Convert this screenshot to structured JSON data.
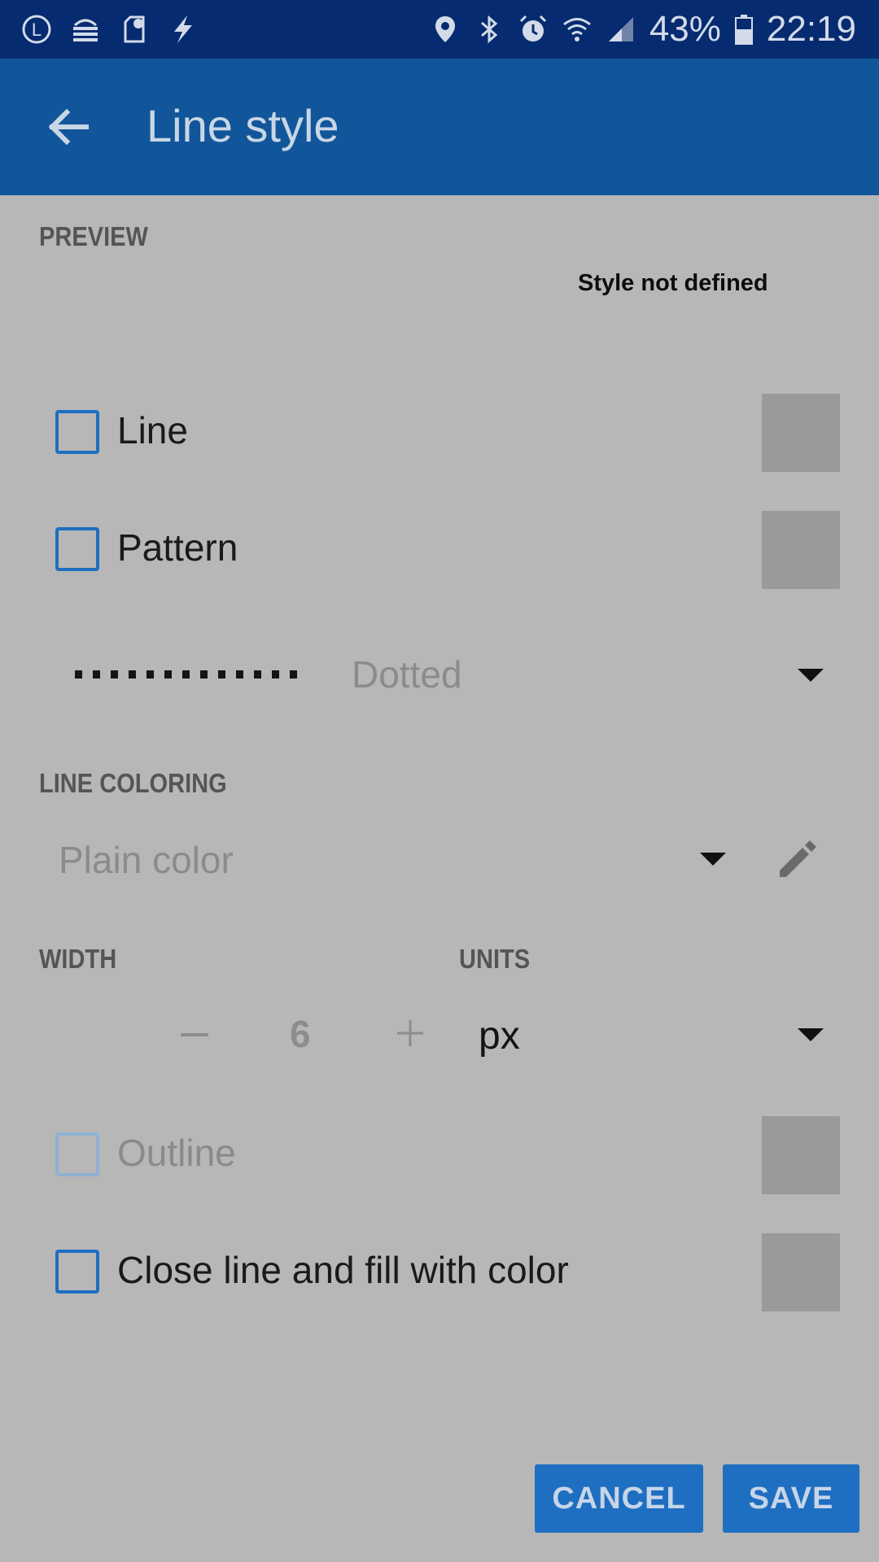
{
  "status_bar": {
    "left_icons": [
      "l-badge-icon",
      "cast-icon",
      "sim-info-icon",
      "flash-icon"
    ],
    "right_icons": [
      "location-pin-icon",
      "bluetooth-icon",
      "alarm-icon",
      "wifi-icon",
      "signal-icon"
    ],
    "battery": "43%",
    "time": "22:19"
  },
  "app_bar": {
    "title": "Line style",
    "back_icon": "arrow-back-icon"
  },
  "preview": {
    "label": "PREVIEW",
    "note": "Style not defined"
  },
  "options": {
    "line": {
      "label": "Line",
      "checked": false
    },
    "pattern": {
      "label": "Pattern",
      "checked": false
    },
    "outline": {
      "label": "Outline",
      "checked": false,
      "enabled": false
    },
    "close_fill": {
      "label": "Close line and fill with color",
      "checked": false
    }
  },
  "pattern_select": {
    "value": "Dotted"
  },
  "line_coloring": {
    "label": "LINE COLORING",
    "value": "Plain color"
  },
  "width": {
    "label": "WIDTH",
    "minus": "−",
    "value": "6",
    "plus": "+"
  },
  "units": {
    "label": "UNITS",
    "value": "px"
  },
  "buttons": {
    "cancel": "CANCEL",
    "save": "SAVE"
  },
  "colors": {
    "status_bar": "#062b70",
    "app_bar": "#11569a",
    "accent": "#1e6ec1",
    "scrim_background": "#b7b7b7"
  }
}
